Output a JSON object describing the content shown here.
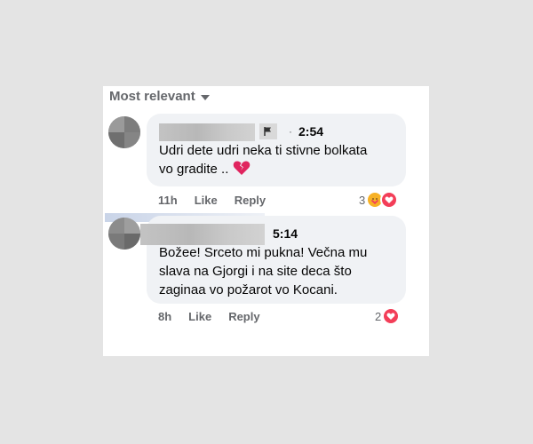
{
  "sort": {
    "label": "Most relevant"
  },
  "comments": [
    {
      "time": "2:54",
      "separator": "·",
      "text_lines": [
        "Udri dete udri neka ti stivne bolkata",
        "vo gradite .."
      ],
      "age": "11h",
      "like_label": "Like",
      "reply_label": "Reply",
      "reaction_count": "3",
      "reaction_icons": [
        "care-icon",
        "heart-icon"
      ]
    },
    {
      "time": "5:14",
      "text_lines": [
        "Božee! Srceto mi pukna! Večna mu",
        "slava na Gjorgi i na site deca što",
        "zaginaa vo požarot vo Kocani."
      ],
      "age": "8h",
      "like_label": "Like",
      "reply_label": "Reply",
      "reaction_count": "2",
      "reaction_icons": [
        "heart-icon"
      ]
    }
  ],
  "colors": {
    "background": "#e4e4e4",
    "bubble": "#f0f2f5",
    "secondary_text": "#65676b",
    "heart": "#f33e58",
    "care": "#f7b125"
  }
}
